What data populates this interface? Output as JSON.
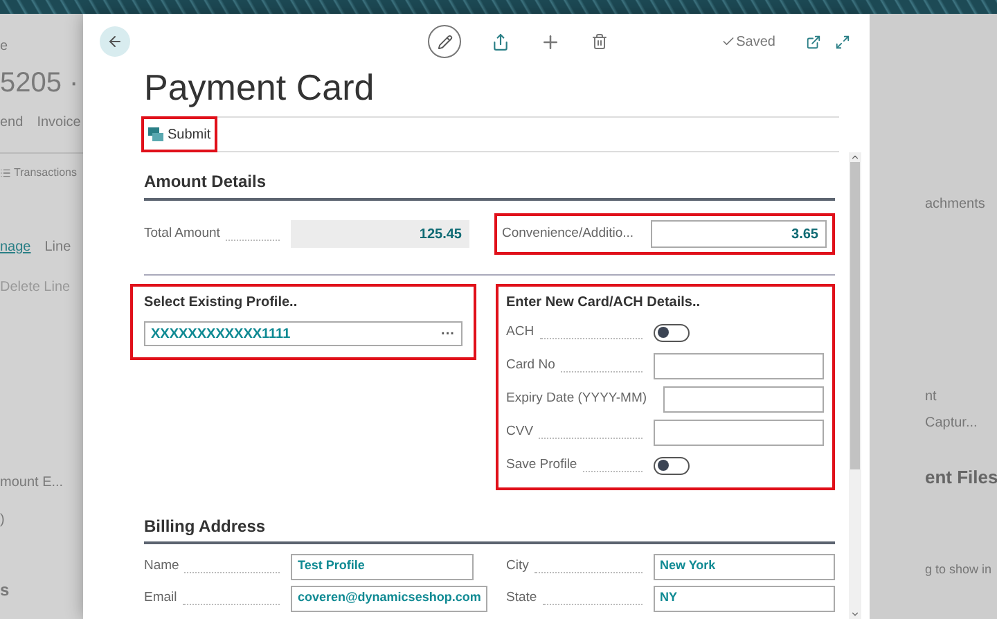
{
  "background_page": {
    "breadcrumb": "e",
    "title": "5205 ·",
    "menu": [
      "end",
      "Invoice"
    ],
    "action": "Transactions",
    "tabs": [
      "nage",
      "Line"
    ],
    "line_action": "Delete Line",
    "fields": [
      "mount E...",
      ")"
    ],
    "section": "s",
    "right_texts": [
      "achments",
      "nt",
      "Captur...",
      "ent Files",
      "g to show in"
    ]
  },
  "header": {
    "status": "Saved"
  },
  "title": "Payment Card",
  "actions": [
    {
      "label": "Submit",
      "highlighted": true
    }
  ],
  "amount_details": {
    "title": "Amount Details",
    "fields": [
      {
        "label": "Total Amount",
        "value": "125.45",
        "editable": false,
        "highlighted": false
      },
      {
        "label": "Convenience/Additio...",
        "value": "3.65",
        "editable": true,
        "highlighted": true
      }
    ]
  },
  "existing_profile": {
    "title": "Select Existing Profile..",
    "value": "XXXXXXXXXXXX1111",
    "lookup": "···",
    "highlighted": true
  },
  "new_card": {
    "title": "Enter New Card/ACH Details..",
    "highlighted": true,
    "fields": [
      {
        "kind": "toggle",
        "label": "ACH",
        "on": false
      },
      {
        "kind": "text",
        "label": "Card No"
      },
      {
        "kind": "text",
        "label": "Expiry Date (YYYY-MM)"
      },
      {
        "kind": "text",
        "label": "CVV"
      },
      {
        "kind": "toggle",
        "label": "Save Profile",
        "on": false
      }
    ]
  },
  "billing_address": {
    "title": "Billing Address",
    "fields": [
      {
        "label": "Name",
        "value": "Test Profile"
      },
      {
        "label": "City",
        "value": "New York"
      },
      {
        "label": "Email",
        "value": "coveren@dynamicseshop.com"
      },
      {
        "label": "State",
        "value": "NY"
      }
    ]
  }
}
